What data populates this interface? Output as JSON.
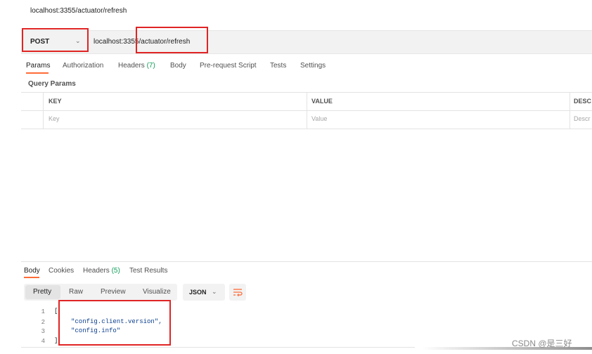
{
  "window": {
    "title_url": "localhost:3355/actuator/refresh"
  },
  "request": {
    "method": "POST",
    "url": "localhost:3355/actuator/refresh"
  },
  "tabs": [
    {
      "label": "Params",
      "active": true
    },
    {
      "label": "Authorization"
    },
    {
      "label": "Headers",
      "count": "(7)"
    },
    {
      "label": "Body"
    },
    {
      "label": "Pre-request Script"
    },
    {
      "label": "Tests"
    },
    {
      "label": "Settings"
    }
  ],
  "query_params": {
    "title": "Query Params",
    "columns": [
      "KEY",
      "VALUE",
      "DESC"
    ],
    "placeholders": [
      "Key",
      "Value",
      "Descr"
    ]
  },
  "response": {
    "tabs": [
      {
        "label": "Body",
        "active": true
      },
      {
        "label": "Cookies"
      },
      {
        "label": "Headers",
        "count": "(5)"
      },
      {
        "label": "Test Results"
      }
    ],
    "view_modes": [
      "Pretty",
      "Raw",
      "Preview",
      "Visualize"
    ],
    "format": "JSON",
    "code_lines": [
      {
        "num": "1",
        "text": "["
      },
      {
        "num": "2",
        "text": "\"config.client.version\","
      },
      {
        "num": "3",
        "text": "\"config.info\""
      },
      {
        "num": "4",
        "text": "]"
      }
    ]
  },
  "watermark": "CSDN @是三好",
  "colors": {
    "accent": "#ff6c37",
    "highlight_box": "#e02424",
    "count_green": "#0f9d58"
  },
  "icons": [
    "chevron-down-icon",
    "wrap-lines-icon"
  ]
}
